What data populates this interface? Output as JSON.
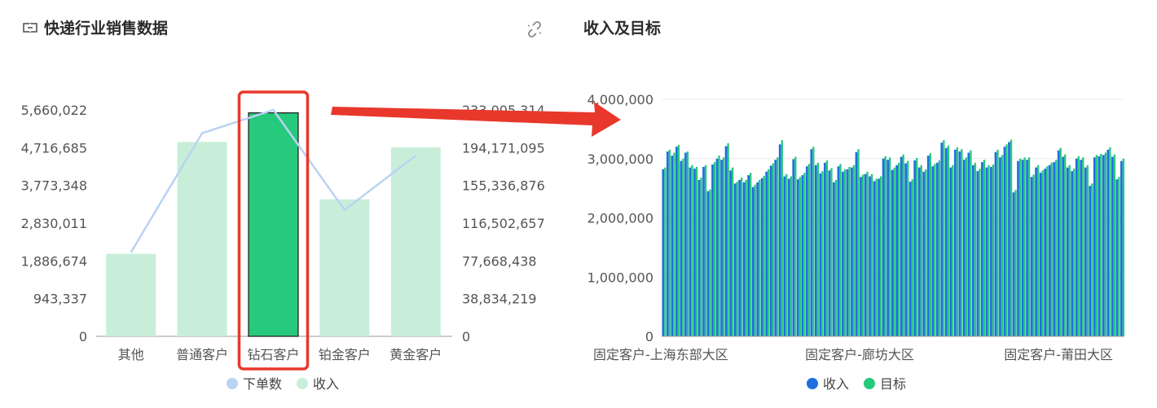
{
  "left_panel": {
    "title": "快递行业销售数据",
    "title_icon": "dataset-icon"
  },
  "link_icon": "unlink-icon",
  "right_panel": {
    "title": "收入及目标"
  },
  "colors": {
    "income_light": "#c8eed9",
    "income_highlight": "#27c97c",
    "orders_line": "#b9d3f3",
    "right_income": "#1f6fe0",
    "right_target": "#27c97c",
    "highlight_box": "#e8382b",
    "arrow": "#e8382b"
  },
  "chart_data": [
    {
      "type": "bar",
      "categories": [
        "其他",
        "普通客户",
        "钻石客户",
        "铂金客户",
        "黄金客户"
      ],
      "series": [
        {
          "name": "下单数",
          "type": "line",
          "axis": "left",
          "values": [
            2100000,
            5080000,
            5660022,
            3160000,
            4520000
          ]
        },
        {
          "name": "收入",
          "type": "bar",
          "axis": "right",
          "values": [
            85000000,
            200000000,
            230000000,
            141000000,
            194500000
          ]
        }
      ],
      "left_axis": {
        "ylim": [
          0,
          5660022
        ],
        "ticks": [
          "0",
          "943,337",
          "1,886,674",
          "2,830,011",
          "3,773,348",
          "4,716,685",
          "5,660,022"
        ]
      },
      "right_axis": {
        "ylim": [
          0,
          233005314
        ],
        "ticks": [
          "0",
          "38,834,219",
          "77,668,438",
          "116,502,657",
          "155,336,876",
          "194,171,095",
          "233,005,314"
        ]
      },
      "highlighted_category": "钻石客户",
      "legend": {
        "position": "bottom",
        "items": [
          "下单数",
          "收入"
        ]
      }
    },
    {
      "type": "bar",
      "ylim": [
        0,
        4000000
      ],
      "y_ticks": [
        "0",
        "1,000,000",
        "2,000,000",
        "3,000,000",
        "4,000,000"
      ],
      "x_tick_labels": [
        "固定客户-上海东部大区",
        "固定客户-廊坊大区",
        "固定客户-莆田大区"
      ],
      "series": [
        {
          "name": "收入",
          "values": [
            2820000,
            3120000,
            3050000,
            3200000,
            2960000,
            3100000,
            2850000,
            2830000,
            2640000,
            2860000,
            2450000,
            2900000,
            3000000,
            2980000,
            3210000,
            2800000,
            2580000,
            2640000,
            2600000,
            2720000,
            2520000,
            2600000,
            2670000,
            2780000,
            2880000,
            2980000,
            3240000,
            2700000,
            2660000,
            2990000,
            2650000,
            2720000,
            2870000,
            3160000,
            2890000,
            2750000,
            2930000,
            2800000,
            2600000,
            2870000,
            2780000,
            2820000,
            2850000,
            3110000,
            2690000,
            2740000,
            2700000,
            2620000,
            2660000,
            3000000,
            2980000,
            2810000,
            2890000,
            3030000,
            2920000,
            2610000,
            2970000,
            2850000,
            2780000,
            3050000,
            2870000,
            2930000,
            3270000,
            3180000,
            2850000,
            3150000,
            3120000,
            2980000,
            3100000,
            2890000,
            2790000,
            2940000,
            2850000,
            2860000,
            3110000,
            3020000,
            3200000,
            3280000,
            2430000,
            2960000,
            2980000,
            2980000,
            2690000,
            2850000,
            2760000,
            2830000,
            2890000,
            2940000,
            3140000,
            3030000,
            2850000,
            2790000,
            3000000,
            2980000,
            2850000,
            2540000,
            3020000,
            3040000,
            3060000,
            3150000,
            3030000,
            2650000,
            2960000
          ],
          "color": "#1f6fe0"
        },
        {
          "name": "目标",
          "values": [
            2850000,
            3150000,
            3100000,
            3230000,
            3000000,
            3120000,
            2890000,
            2860000,
            2680000,
            2890000,
            2480000,
            2940000,
            3050000,
            3020000,
            3260000,
            2850000,
            2610000,
            2680000,
            2640000,
            2760000,
            2560000,
            2640000,
            2710000,
            2820000,
            2920000,
            3020000,
            3310000,
            2740000,
            2700000,
            3030000,
            2690000,
            2760000,
            2910000,
            3200000,
            2930000,
            2790000,
            2970000,
            2840000,
            2640000,
            2910000,
            2820000,
            2860000,
            2890000,
            3160000,
            2730000,
            2780000,
            2740000,
            2660000,
            2700000,
            3040000,
            3020000,
            2850000,
            2930000,
            3070000,
            2960000,
            2650000,
            3010000,
            2890000,
            2820000,
            3090000,
            2910000,
            2970000,
            3310000,
            3220000,
            2890000,
            3190000,
            3160000,
            3020000,
            3140000,
            2930000,
            2830000,
            2980000,
            2890000,
            2900000,
            3150000,
            3060000,
            3240000,
            3320000,
            2470000,
            3000000,
            3020000,
            3020000,
            2730000,
            2890000,
            2800000,
            2870000,
            2930000,
            2980000,
            3180000,
            3070000,
            2890000,
            2830000,
            3040000,
            3020000,
            2890000,
            2580000,
            3060000,
            3080000,
            3100000,
            3190000,
            3070000,
            2690000,
            3000000
          ],
          "color": "#27c97c"
        }
      ],
      "legend": {
        "position": "bottom",
        "items": [
          "收入",
          "目标"
        ]
      }
    }
  ]
}
